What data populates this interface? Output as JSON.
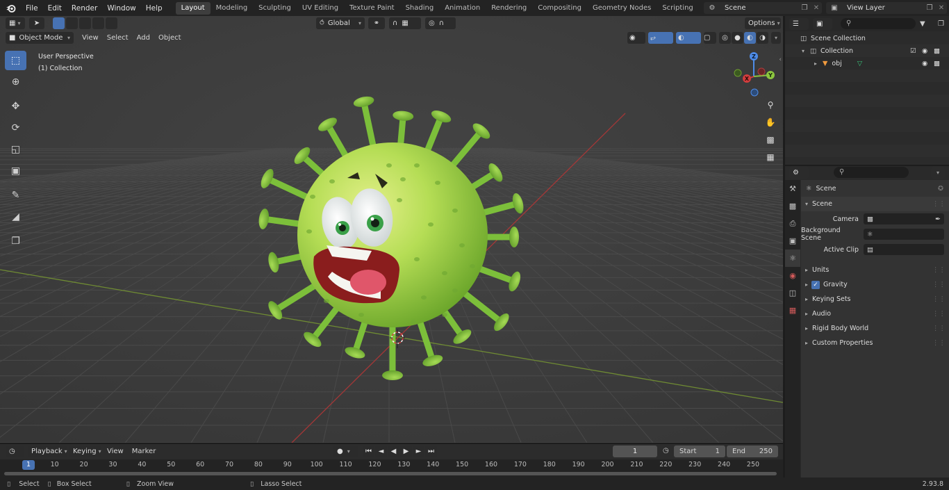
{
  "menubar": {
    "items": [
      "File",
      "Edit",
      "Render",
      "Window",
      "Help"
    ]
  },
  "workspaces": {
    "tabs": [
      "Layout",
      "Modeling",
      "Sculpting",
      "UV Editing",
      "Texture Paint",
      "Shading",
      "Animation",
      "Rendering",
      "Compositing",
      "Geometry Nodes",
      "Scripting"
    ],
    "active": "Layout"
  },
  "scene_selector": {
    "value": "Scene"
  },
  "view_layer_selector": {
    "value": "View Layer"
  },
  "viewport": {
    "mode": "Object Mode",
    "menus": [
      "View",
      "Select",
      "Add",
      "Object"
    ],
    "transform_orientation": "Global",
    "options_label": "Options",
    "overlay_title": "User Perspective",
    "overlay_collection": "(1) Collection",
    "gizmo": {
      "x": "X",
      "y": "Y",
      "z": "Z"
    }
  },
  "outliner": {
    "rows": [
      {
        "label": "Scene Collection"
      },
      {
        "label": "Collection"
      },
      {
        "label": "obj"
      }
    ]
  },
  "properties": {
    "header": "Scene",
    "section": "Scene",
    "fields": [
      {
        "label": "Camera"
      },
      {
        "label": "Background Scene"
      },
      {
        "label": "Active Clip"
      }
    ],
    "panels": [
      "Units",
      "Gravity",
      "Keying Sets",
      "Audio",
      "Rigid Body World",
      "Custom Properties"
    ],
    "gravity_checked": true
  },
  "timeline": {
    "menus": [
      "Playback",
      "Keying",
      "View",
      "Marker"
    ],
    "current_frame": "1",
    "start_label": "Start",
    "start_value": "1",
    "end_label": "End",
    "end_value": "250",
    "ruler_ticks": [
      "1",
      "10",
      "20",
      "30",
      "40",
      "50",
      "60",
      "70",
      "80",
      "90",
      "100",
      "110",
      "120",
      "130",
      "140",
      "150",
      "160",
      "170",
      "180",
      "190",
      "200",
      "210",
      "220",
      "230",
      "240",
      "250"
    ]
  },
  "statusbar": {
    "items": [
      "Select",
      "Box Select",
      "Zoom View",
      "Lasso Select"
    ],
    "version": "2.93.8"
  },
  "colors": {
    "accent": "#4772b3",
    "x_axis": "#d23d3d",
    "y_axis": "#8cc63f",
    "z_axis": "#4e8ce8",
    "virus_green": "#8ccd3c"
  }
}
